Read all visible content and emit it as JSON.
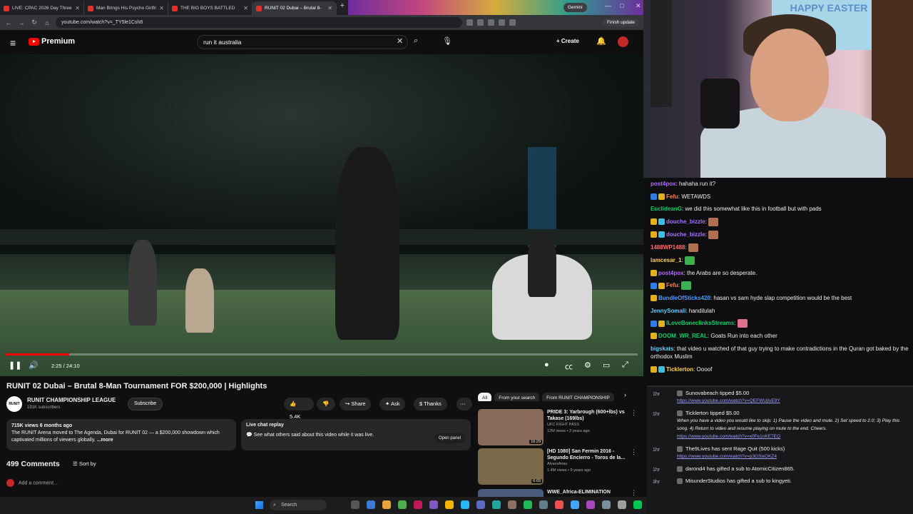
{
  "browser": {
    "tabs": [
      {
        "title": "LIVE: CPAC 2026 Day Three Fe",
        "active": false
      },
      {
        "title": "Man Brings His Psycho Girlfrien",
        "active": false
      },
      {
        "title": "THE BIG BOYS BATTLED",
        "active": false
      },
      {
        "title": "RUNIT 02 Dubai – Brutal 8-",
        "active": true
      }
    ],
    "gemini": "Gemini",
    "url": "youtube.com/watch?v=_TY5le1Csh8",
    "finish_update": "Finish update"
  },
  "youtube": {
    "logo": "Premium",
    "search_value": "run it australia",
    "create": "Create"
  },
  "player": {
    "time": "2:25 / 24:10",
    "progress_fraction": 0.1
  },
  "video": {
    "title": "RUNIT 02 Dubai – Brutal 8-Man Tournament FOR $200,000 | Highlights",
    "channel_icon_text": "RUNIT",
    "channel": "RUNIT CHAMPIONSHIP LEAGUE",
    "subscribers": "191K subscribers",
    "subscribe": "Subscribe",
    "likes": "5.4K",
    "share": "Share",
    "ask": "Ask",
    "thanks": "Thanks",
    "views_meta": "715K views  6 months ago",
    "description": "The RUNIT Arena moved to The Agenda, Dubai for RUNIT 02 — a $200,000 showdown which captivated millions of viewers globally.",
    "more": "...more",
    "live_title": "Live chat replay",
    "live_sub": "See what others said about this video while it was live.",
    "open_panel": "Open panel",
    "comments": "499 Comments",
    "sort_by": "Sort by",
    "add_comment": "Add a comment..."
  },
  "chips": [
    "All",
    "From your search",
    "From RUNIT CHAMPIONSHIP"
  ],
  "recommendations": [
    {
      "title": "PRIDE 3: Yarbrough (600+lbs) vs Takase (169lbs)",
      "channel": "UFC FIGHT PASS",
      "meta": "12M views • 3 years ago",
      "duration": "16:29",
      "color": "#8a6a5a"
    },
    {
      "title": "[HD 1080] San Fermin 2016 - Segundo Encierro - Toros de la...",
      "channel": "AlvaroArias",
      "meta": "1.4M views • 9 years ago",
      "duration": "6:03",
      "color": "#7a6a4a"
    },
    {
      "title": "WWE_Africa-ELIMINATION",
      "channel": "",
      "meta": "",
      "duration": "",
      "color": "#4a5a7a"
    }
  ],
  "webcam": {
    "text": "HAPPY EASTER"
  },
  "chat": [
    {
      "user": "post4pox",
      "color": "#b069ff",
      "text": "hahaha run it?"
    },
    {
      "user": "Fefu",
      "color": "#ff7f50",
      "text": "WETAWDS"
    },
    {
      "user": "EuclideanG",
      "color": "#00d26a",
      "text": "we did this somewhat like this in football but with pads"
    },
    {
      "user": "douche_bizzle",
      "color": "#a970ff",
      "text": ""
    },
    {
      "user": "douche_bizzle",
      "color": "#a970ff",
      "text": ""
    },
    {
      "user": "1488WP1488",
      "color": "#ff6a6a",
      "text": ""
    },
    {
      "user": "lamcesar_1",
      "color": "#ffd34d",
      "text": ""
    },
    {
      "user": "post4pox",
      "color": "#b069ff",
      "text": "the Arabs are so desperate."
    },
    {
      "user": "Fefu",
      "color": "#ff7f50",
      "text": ""
    },
    {
      "user": "BundleOfSticks420",
      "color": "#4d9fff",
      "text": "hasan vs sam hyde slap competition would be the best"
    },
    {
      "user": "JennySomali",
      "color": "#5ad1ff",
      "text": "handilulah"
    },
    {
      "user": "ILoveBoneclinksStreams",
      "color": "#00d26a",
      "text": ""
    },
    {
      "user": "DOOM_WR_REAL",
      "color": "#00d26a",
      "text": "Goats Run into each other"
    },
    {
      "user": "bigskats",
      "color": "#5ad1ff",
      "text": "that video u watched of that guy trying to make contradictions in the Quran got baked by the orthodox Muslim"
    },
    {
      "user": "Ticklerton",
      "color": "#ffd34d",
      "text": "Oooof"
    }
  ],
  "events": [
    {
      "time": "1hr",
      "line": "Sunovabeach tipped $5.00",
      "link": "https://www.youtube.com/watch?v=QEFWUjIvE9Y"
    },
    {
      "time": "1hr",
      "line": "Ticklerton tipped $5.00",
      "note": "When you have a video you would like to skip: 1) Pause the video and mute. 2) Set speed to 2.0; 3) Play this song. 4) Return to video and resume playing on mute to the end. Cheers.",
      "link": "https://www.youtube.com/watch?v=x0Fe1nKE7EQ"
    },
    {
      "time": "1hr",
      "line": "The9Lives has sent Rage Quit (500 kicks)",
      "link": "https://www.youtube.com/watch?v=p3GSixOKZ4"
    },
    {
      "time": "1hr",
      "line": "darond4 has gifted a sub to AtomicCitizen865.",
      "link": ""
    },
    {
      "time": "3hr",
      "line": "MisunderStudios has gifted a sub to kingyeti.",
      "link": ""
    }
  ],
  "taskbar": {
    "search": "Search"
  }
}
